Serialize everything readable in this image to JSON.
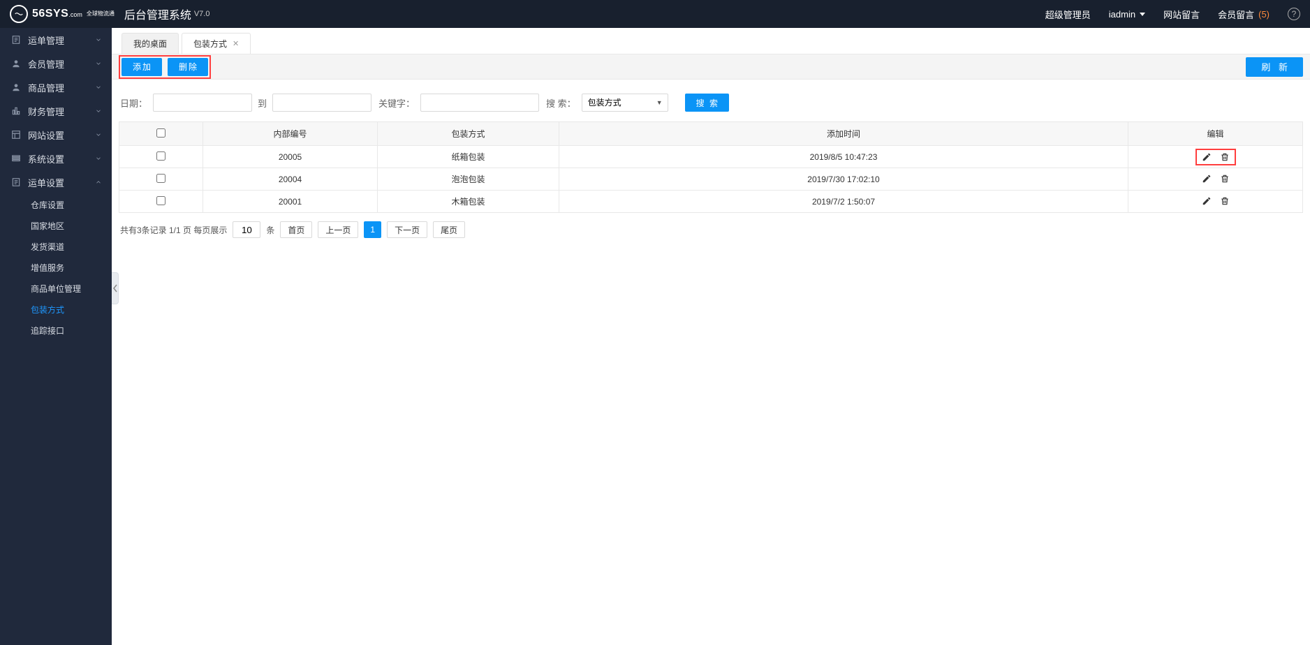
{
  "brand": {
    "logo_text": "56SYS",
    "logo_domain": ".com",
    "logo_tag": "全球物流通"
  },
  "app": {
    "title": "后台管理系统",
    "version": "V7.0"
  },
  "header": {
    "role": "超级管理员",
    "user": "iadmin",
    "site_msg": "网站留言",
    "member_msg": "会员留言",
    "member_msg_count": "(5)"
  },
  "sidebar": {
    "items": [
      {
        "label": "运单管理",
        "icon": "order"
      },
      {
        "label": "会员管理",
        "icon": "user"
      },
      {
        "label": "商品管理",
        "icon": "user"
      },
      {
        "label": "财务管理",
        "icon": "finance"
      },
      {
        "label": "网站设置",
        "icon": "layout"
      },
      {
        "label": "系统设置",
        "icon": "gear"
      },
      {
        "label": "运单设置",
        "icon": "order",
        "expanded": true
      }
    ],
    "sub": [
      {
        "label": "仓库设置"
      },
      {
        "label": "国家地区"
      },
      {
        "label": "发货渠道"
      },
      {
        "label": "增值服务"
      },
      {
        "label": "商品单位管理"
      },
      {
        "label": "包装方式",
        "active": true
      },
      {
        "label": "追踪接口"
      }
    ]
  },
  "tabs": [
    {
      "label": "我的桌面",
      "active": true
    },
    {
      "label": "包装方式",
      "closable": true
    }
  ],
  "actions": {
    "add": "添加",
    "delete": "删除",
    "refresh": "刷 新"
  },
  "filters": {
    "date_label": "日期：",
    "to_label": "到",
    "keyword_label": "关键字：",
    "search_label": "搜 索：",
    "select_value": "包装方式",
    "search_button": "搜  索"
  },
  "table": {
    "columns": {
      "id": "内部编号",
      "type": "包装方式",
      "time": "添加时间",
      "edit": "编辑"
    },
    "rows": [
      {
        "id": "20005",
        "type": "纸箱包装",
        "time": "2019/8/5 10:47:23",
        "highlight": true
      },
      {
        "id": "20004",
        "type": "泡泡包装",
        "time": "2019/7/30 17:02:10"
      },
      {
        "id": "20001",
        "type": "木箱包装",
        "time": "2019/7/2 1:50:07"
      }
    ]
  },
  "pagination": {
    "summary": "共有3条记录  1/1 页  每页展示",
    "per_page": "10",
    "unit": "条",
    "first": "首页",
    "prev": "上一页",
    "current": "1",
    "next": "下一页",
    "last": "尾页"
  }
}
